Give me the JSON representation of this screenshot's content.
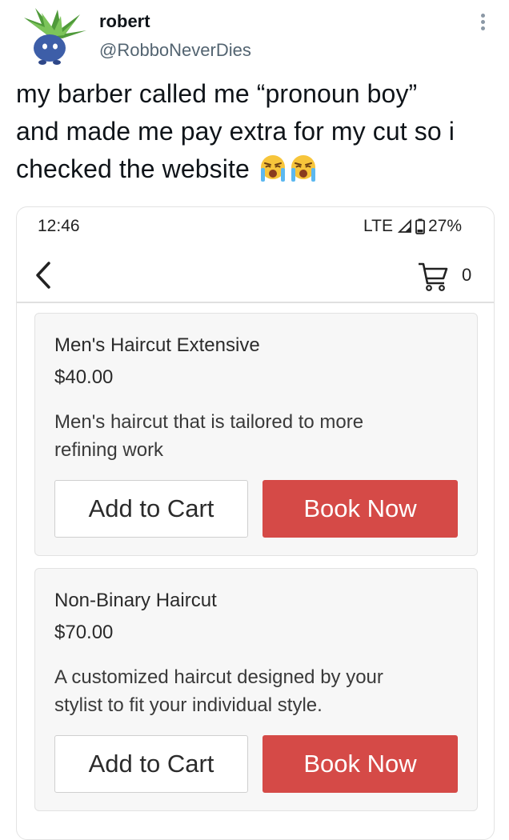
{
  "tweet": {
    "display_name": "robert",
    "handle": "@RobboNeverDies",
    "text_line1": "my barber called me “pronoun boy”",
    "text_line2": "and made me pay extra for my cut so i",
    "text_line3": "checked the website",
    "emoji": "loudly-crying-face-icon",
    "avatar_icon": "oddish-avatar-icon"
  },
  "screenshot": {
    "status_bar": {
      "time": "12:46",
      "network": "LTE",
      "battery": "27%"
    },
    "app_bar": {
      "back_icon": "chevron-left-icon",
      "cart_icon": "cart-icon",
      "cart_count": "0"
    },
    "services": [
      {
        "title": "Men's Haircut Extensive",
        "price": "$40.00",
        "desc_line1": "Men's haircut that is tailored to more",
        "desc_line2": "refining work",
        "add_label": "Add to Cart",
        "book_label": "Book Now"
      },
      {
        "title": "Non-Binary Haircut",
        "price": "$70.00",
        "desc_line1": "A customized haircut designed by your",
        "desc_line2": "stylist to fit your individual style.",
        "add_label": "Add to Cart",
        "book_label": "Book Now"
      }
    ]
  },
  "colors": {
    "book_button": "#d54a47",
    "handle_text": "#536471",
    "card_background": "#f7f7f7"
  }
}
